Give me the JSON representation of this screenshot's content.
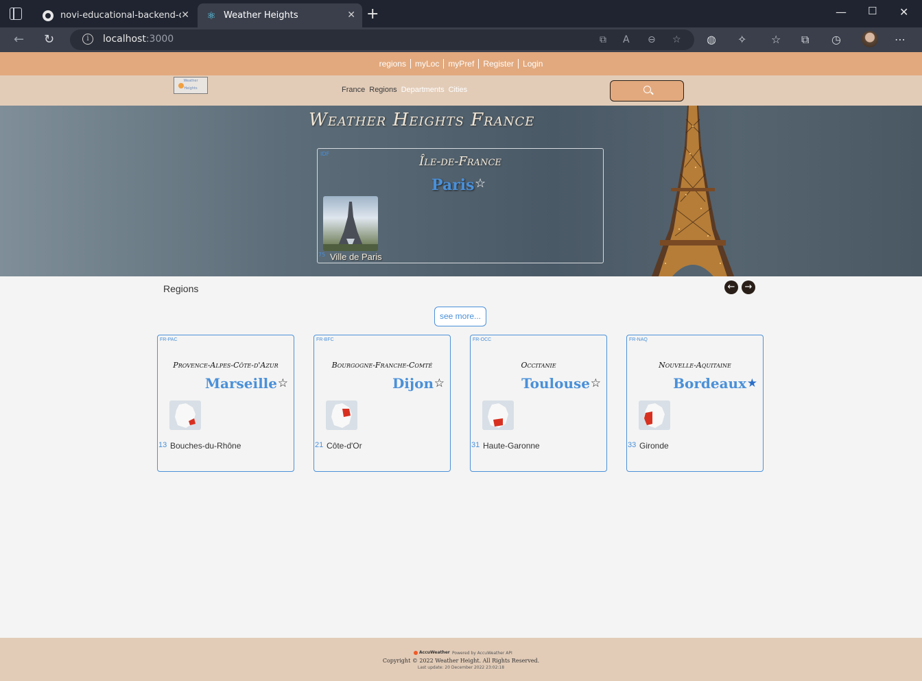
{
  "browser": {
    "tabs": [
      {
        "title": "novi-educational-backend-docum",
        "icon": "github-icon"
      },
      {
        "title": "Weather Heights",
        "icon": "react-icon",
        "active": true
      }
    ],
    "url_host": "localhost",
    "url_port": ":3000"
  },
  "topnav": {
    "links": [
      "regions",
      "myLoc",
      "myPref",
      "Register",
      "Login"
    ]
  },
  "mainnav": {
    "logo_text_top": "Weather",
    "logo_text_bottom": "Heights",
    "links": [
      {
        "label": "France",
        "style": "dark"
      },
      {
        "label": "Regions",
        "style": "dark"
      },
      {
        "label": "Departments",
        "style": "light"
      },
      {
        "label": "Cities",
        "style": "light"
      }
    ]
  },
  "hero": {
    "title": "Weather Heights France",
    "featured": {
      "code": "IDF",
      "region": "Île-de-France",
      "city": "Paris",
      "dept_num": "75",
      "dept_name": "Ville de Paris"
    }
  },
  "regions_section": {
    "label": "Regions",
    "prev_icon": "arrow-left-icon",
    "next_icon": "arrow-right-icon",
    "see_more": "see more..."
  },
  "cards": [
    {
      "code": "FR-PAC",
      "region": "Provence-Alpes-Côte-d'Azur",
      "city": "Marseille",
      "dept_num": "13",
      "dept_name": "Bouches-du-Rhône",
      "favorite": false
    },
    {
      "code": "FR-BFC",
      "region": "Bourgogne-Franche-Comté",
      "city": "Dijon",
      "dept_num": "21",
      "dept_name": "Côte-d'Or",
      "favorite": false
    },
    {
      "code": "FR-OCC",
      "region": "Occitanie",
      "city": "Toulouse",
      "dept_num": "31",
      "dept_name": "Haute-Garonne",
      "favorite": false
    },
    {
      "code": "FR-NAQ",
      "region": "Nouvelle-Aquitaine",
      "city": "Bordeaux",
      "dept_num": "33",
      "dept_name": "Gironde",
      "favorite": true
    }
  ],
  "footer": {
    "accuweather": "AccuWeather",
    "powered": "Powered by AccuWeather API",
    "copyright": "Copyright © 2022 Weather Height. All Rights Reserved.",
    "last_update": "Last update: 20 December 2022 23:02:18"
  },
  "colors": {
    "accent": "#4a90d9",
    "topnav": "#e2a97e",
    "mainnav": "#e2ccb8"
  }
}
